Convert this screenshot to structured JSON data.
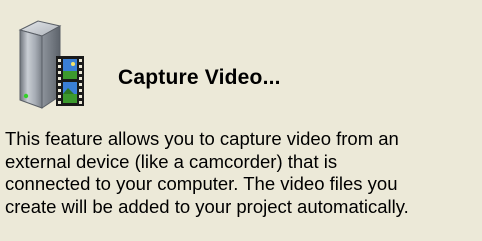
{
  "task": {
    "icon": "video-capture-device-icon",
    "title": "Capture Video...",
    "description_lines": [
      "This feature allows you to capture video from an",
      "external device (like a camcorder) that is",
      "connected to your computer.  The video files you",
      "create will be added to your project automatically."
    ]
  },
  "colors": {
    "background": "#ece9d8",
    "device_body": "#9aa0a8",
    "film": "#1a1a1a",
    "frame_sky": "#3a7fd6",
    "frame_grass": "#3c9a2e",
    "led": "#35d02a"
  }
}
